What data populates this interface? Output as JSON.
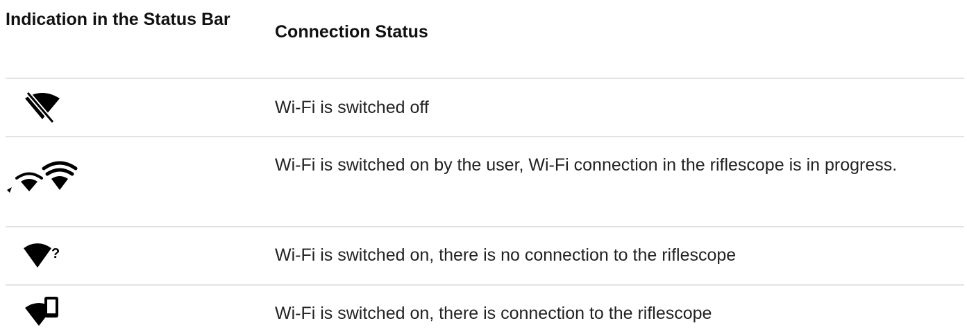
{
  "headers": {
    "indication": "Indication in the Status Bar",
    "status": "Connection Status"
  },
  "rows": [
    {
      "icon": "wifi-off-icon",
      "text": "Wi-Fi is switched off"
    },
    {
      "icon": "wifi-connecting-icon",
      "text": "Wi-Fi is switched on by the user, Wi-Fi connection in the riflescope is in progress."
    },
    {
      "icon": "wifi-no-connection-icon",
      "text": "Wi-Fi is switched on, there is no connection to the riflescope"
    },
    {
      "icon": "wifi-connected-device-icon",
      "text": "Wi-Fi is switched on, there is connection to the riflescope"
    }
  ],
  "colors": {
    "text": "#222222",
    "divider": "#e3e3e3",
    "icon": "#000000"
  }
}
